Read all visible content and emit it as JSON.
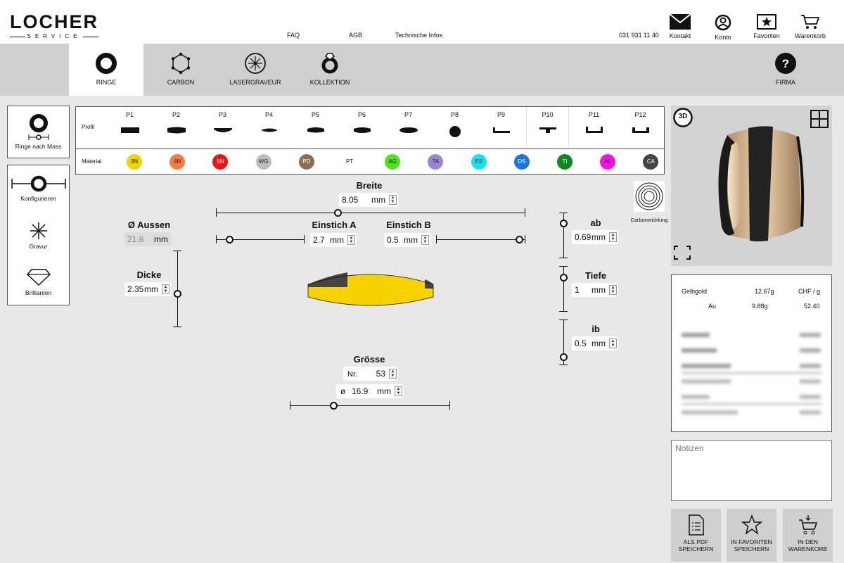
{
  "logo": {
    "main": "LOCHER",
    "sub": "SERVICE"
  },
  "header": {
    "links": [
      "FAQ",
      "AGB",
      "Technische Infos"
    ],
    "phone": "031 931 11 40",
    "icons": [
      {
        "label": "Kontakt",
        "icon": "mail-icon"
      },
      {
        "label": "Konto",
        "icon": "account-icon"
      },
      {
        "label": "Favoriten",
        "icon": "favorites-star-icon"
      },
      {
        "label": "Warenkorb",
        "icon": "cart-icon"
      }
    ]
  },
  "nav": {
    "tabs": [
      {
        "label": "RINGE",
        "icon": "ring-icon",
        "active": true
      },
      {
        "label": "CARBON",
        "icon": "carbon-icon"
      },
      {
        "label": "LASERGRAVEUR",
        "icon": "laser-icon"
      },
      {
        "label": "KOLLEKTION",
        "icon": "collection-ring-icon"
      }
    ],
    "firma": "FIRMA"
  },
  "sidebar": {
    "ringe_nach_mass": "Ringe nach Mass",
    "items": [
      {
        "label": "Konfigurieren",
        "icon": "configure-icon",
        "active": true
      },
      {
        "label": "Gravur",
        "icon": "engraving-icon"
      },
      {
        "label": "Brillianten",
        "icon": "diamond-icon"
      }
    ]
  },
  "profile": {
    "label": "Profil",
    "selected": "P10",
    "items": [
      "P1",
      "P2",
      "P3",
      "P4",
      "P5",
      "P6",
      "P7",
      "P8",
      "P9",
      "P10",
      "P11",
      "P12"
    ]
  },
  "material": {
    "label": "Material",
    "selected": "3N",
    "items": [
      {
        "code": "3N",
        "color": "#f2d200"
      },
      {
        "code": "4N",
        "color": "#f47d3f"
      },
      {
        "code": "5N",
        "color": "#e8161b"
      },
      {
        "code": "WG",
        "color": "#bdbdbd"
      },
      {
        "code": "PD",
        "color": "#8c6e57"
      },
      {
        "code": "PT",
        "color": "#ffffff"
      },
      {
        "code": "AG",
        "color": "#4fe31c"
      },
      {
        "code": "TA",
        "color": "#9b87d6"
      },
      {
        "code": "ES",
        "color": "#13e2ef"
      },
      {
        "code": "DS",
        "color": "#1976e0"
      },
      {
        "code": "TI",
        "color": "#0a8a21"
      },
      {
        "code": "AL",
        "color": "#f014e6"
      },
      {
        "code": "CA",
        "color": "#444444"
      }
    ]
  },
  "config": {
    "breite": {
      "label": "Breite",
      "value": "8.05",
      "unit": "mm"
    },
    "aussen": {
      "label": "Ø Aussen",
      "value": "21.6",
      "unit": "mm"
    },
    "einstich_a": {
      "label": "Einstich A",
      "value": "2.7",
      "unit": "mm"
    },
    "einstich_b": {
      "label": "Einstich B",
      "value": "0.5",
      "unit": "mm"
    },
    "dicke": {
      "label": "Dicke",
      "value": "2.35",
      "unit": "mm"
    },
    "ab": {
      "label": "ab",
      "value": "0.69",
      "unit": "mm"
    },
    "tiefe": {
      "label": "Tiefe",
      "value": "1",
      "unit": "mm"
    },
    "ib": {
      "label": "ib",
      "value": "0.5",
      "unit": "mm"
    },
    "groesse": {
      "label": "Grösse",
      "nr_label": "Nr.",
      "nr_value": "53",
      "dia_label": "ø",
      "dia_value": "16.9",
      "unit": "mm"
    },
    "carbon_label": "Carbonwicklung"
  },
  "preview": {
    "badge": "3D"
  },
  "price": {
    "header": {
      "material": "Gelbgold",
      "weight": "12.67g",
      "unit": "CHF / g"
    },
    "alloy": {
      "element": "Au",
      "weight": "9.88g",
      "price": "52.40"
    }
  },
  "notes": {
    "placeholder": "Notizen"
  },
  "actions": [
    {
      "line1": "ALS PDF",
      "line2": "SPEICHERN",
      "icon": "pdf-document-icon"
    },
    {
      "line1": "IN FAVORITEN",
      "line2": "SPEICHERN",
      "icon": "star-outline-icon"
    },
    {
      "line1": "IN DEN",
      "line2": "WARENKORB",
      "icon": "cart-add-icon"
    }
  ]
}
